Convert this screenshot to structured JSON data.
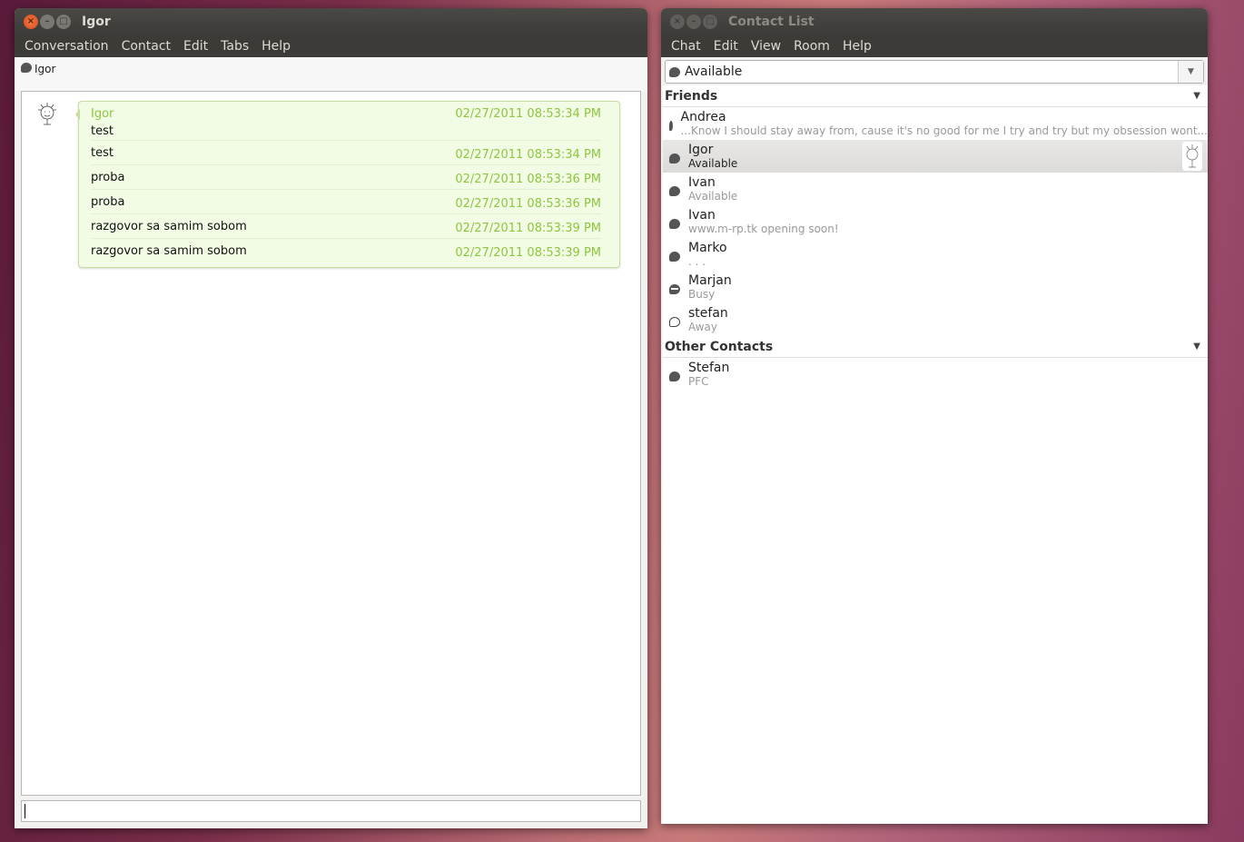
{
  "chat_window": {
    "title": "Igor",
    "menu": [
      "Conversation",
      "Contact",
      "Edit",
      "Tabs",
      "Help"
    ],
    "tab_label": "Igor",
    "messages": {
      "sender": "Igor",
      "rows": [
        {
          "text": "test",
          "time": "02/27/2011 08:53:34 PM"
        },
        {
          "text": "test",
          "time": "02/27/2011 08:53:34 PM"
        },
        {
          "text": "proba",
          "time": "02/27/2011 08:53:36 PM"
        },
        {
          "text": "proba",
          "time": "02/27/2011 08:53:36 PM"
        },
        {
          "text": "razgovor sa samim sobom",
          "time": "02/27/2011 08:53:39 PM"
        },
        {
          "text": "razgovor sa samim sobom",
          "time": "02/27/2011 08:53:39 PM"
        }
      ]
    },
    "input_value": ""
  },
  "contact_window": {
    "title": "Contact List",
    "menu": [
      "Chat",
      "Edit",
      "View",
      "Room",
      "Help"
    ],
    "presence": "Available",
    "groups": [
      {
        "name": "Friends",
        "contacts": [
          {
            "name": "Andrea",
            "status": "...Know I should stay away from, cause it's no good for me I try and try but my obsession wont...",
            "icon": "available-icon"
          },
          {
            "name": "Igor",
            "status": "Available",
            "icon": "available-icon",
            "selected": true
          },
          {
            "name": "Ivan",
            "status": "Available",
            "icon": "available-icon"
          },
          {
            "name": "Ivan",
            "status": "www.m-rp.tk opening soon!",
            "icon": "available-icon"
          },
          {
            "name": "Marko",
            "status": ". . .",
            "icon": "available-icon"
          },
          {
            "name": "Marjan",
            "status": "Busy",
            "icon": "busy-icon"
          },
          {
            "name": "stefan",
            "status": "Away",
            "icon": "away-icon"
          }
        ]
      },
      {
        "name": "Other Contacts",
        "contacts": [
          {
            "name": "Stefan",
            "status": "PFC",
            "icon": "available-icon"
          }
        ]
      }
    ]
  }
}
